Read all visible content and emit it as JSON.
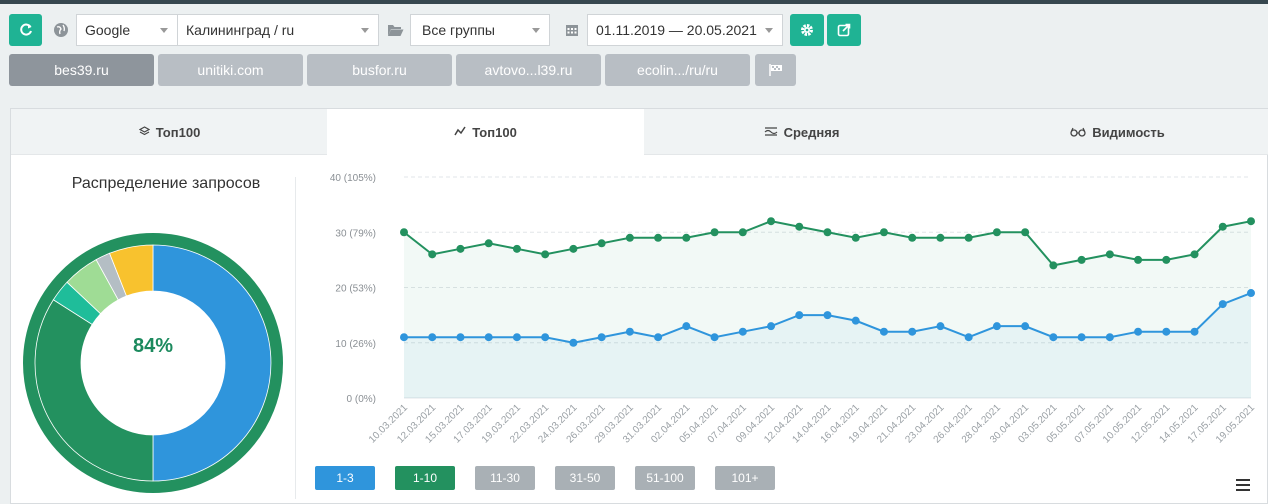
{
  "toolbar": {
    "engine": "Google",
    "region": "Калининград / ru",
    "group": "Все группы",
    "date_range": "01.11.2019 — 20.05.2021"
  },
  "sites": [
    {
      "label": "bes39.ru",
      "active": true
    },
    {
      "label": "unitiki.com",
      "active": false
    },
    {
      "label": "busfor.ru",
      "active": false
    },
    {
      "label": "avtovo...l39.ru",
      "active": false
    },
    {
      "label": "ecolin.../ru/ru",
      "active": false
    }
  ],
  "tabs": [
    {
      "label": "Топ100",
      "icon": "layers-icon",
      "active": false
    },
    {
      "label": "Топ100",
      "icon": "line-chart-icon",
      "active": true
    },
    {
      "label": "Средняя",
      "icon": "average-icon",
      "active": false
    },
    {
      "label": "Видимость",
      "icon": "glasses-icon",
      "active": false
    }
  ],
  "donut": {
    "title": "Распределение запросов",
    "center_label": "84%",
    "outer_ring_color": "#23915f",
    "slices": [
      {
        "value": 50,
        "color": "#2f95dc"
      },
      {
        "value": 34,
        "color": "#23915f"
      },
      {
        "value": 3,
        "color": "#1fbd9a"
      },
      {
        "value": 5,
        "color": "#9fdc95"
      },
      {
        "value": 2,
        "color": "#b4bec4"
      },
      {
        "value": 6,
        "color": "#f8c22e"
      }
    ]
  },
  "range_buttons": [
    {
      "label": "1-3",
      "color": "#2f95dc"
    },
    {
      "label": "1-10",
      "color": "#23915f"
    },
    {
      "label": "11-30",
      "color": "#a9b0b5"
    },
    {
      "label": "31-50",
      "color": "#a9b0b5"
    },
    {
      "label": "51-100",
      "color": "#a9b0b5"
    },
    {
      "label": "101+",
      "color": "#a9b0b5"
    }
  ],
  "chart_data": {
    "type": "line",
    "y_ticks": [
      "0 (0%)",
      "10 (26%)",
      "20 (53%)",
      "30 (79%)",
      "40 (105%)"
    ],
    "ylim": [
      0,
      40
    ],
    "grid": true,
    "x": [
      "10.03.2021",
      "12.03.2021",
      "15.03.2021",
      "17.03.2021",
      "19.03.2021",
      "22.03.2021",
      "24.03.2021",
      "26.03.2021",
      "29.03.2021",
      "31.03.2021",
      "02.04.2021",
      "05.04.2021",
      "07.04.2021",
      "09.04.2021",
      "12.04.2021",
      "14.04.2021",
      "16.04.2021",
      "19.04.2021",
      "21.04.2021",
      "23.04.2021",
      "26.04.2021",
      "28.04.2021",
      "30.04.2021",
      "03.05.2021",
      "05.05.2021",
      "07.05.2021",
      "10.05.2021",
      "12.05.2021",
      "14.05.2021",
      "17.05.2021",
      "19.05.2021"
    ],
    "series": [
      {
        "color": "#23915f",
        "values": [
          30,
          26,
          27,
          28,
          27,
          26,
          27,
          28,
          29,
          29,
          29,
          30,
          30,
          32,
          31,
          30,
          29,
          30,
          29,
          29,
          29,
          30,
          30,
          24,
          25,
          26,
          25,
          25,
          26,
          31,
          32
        ]
      },
      {
        "color": "#2f95dc",
        "values": [
          11,
          11,
          11,
          11,
          11,
          11,
          10,
          11,
          12,
          11,
          13,
          11,
          12,
          13,
          15,
          15,
          14,
          12,
          12,
          13,
          11,
          13,
          13,
          11,
          11,
          11,
          12,
          12,
          12,
          17,
          19
        ]
      }
    ]
  }
}
